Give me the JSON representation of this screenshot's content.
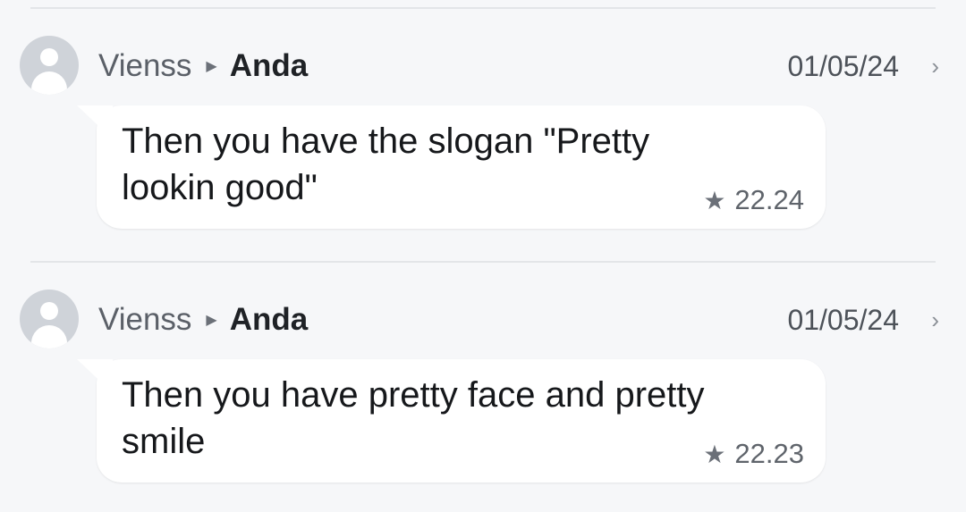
{
  "messages": [
    {
      "sender": "Vienss",
      "recipient": "Anda",
      "date": "01/05/24",
      "text": "Then you have the slogan \"Pretty lookin good\"",
      "time": "22.24",
      "starred": true
    },
    {
      "sender": "Vienss",
      "recipient": "Anda",
      "date": "01/05/24",
      "text": "Then you have pretty face and pretty smile",
      "time": "22.23",
      "starred": true
    }
  ],
  "icons": {
    "separator": "play-triangle-icon",
    "chevron": "chevron-right-icon",
    "star": "star-icon",
    "avatar": "default-avatar-icon"
  },
  "colors": {
    "background": "#f6f7f9",
    "bubble": "#ffffff",
    "avatar": "#cfd3d9"
  }
}
